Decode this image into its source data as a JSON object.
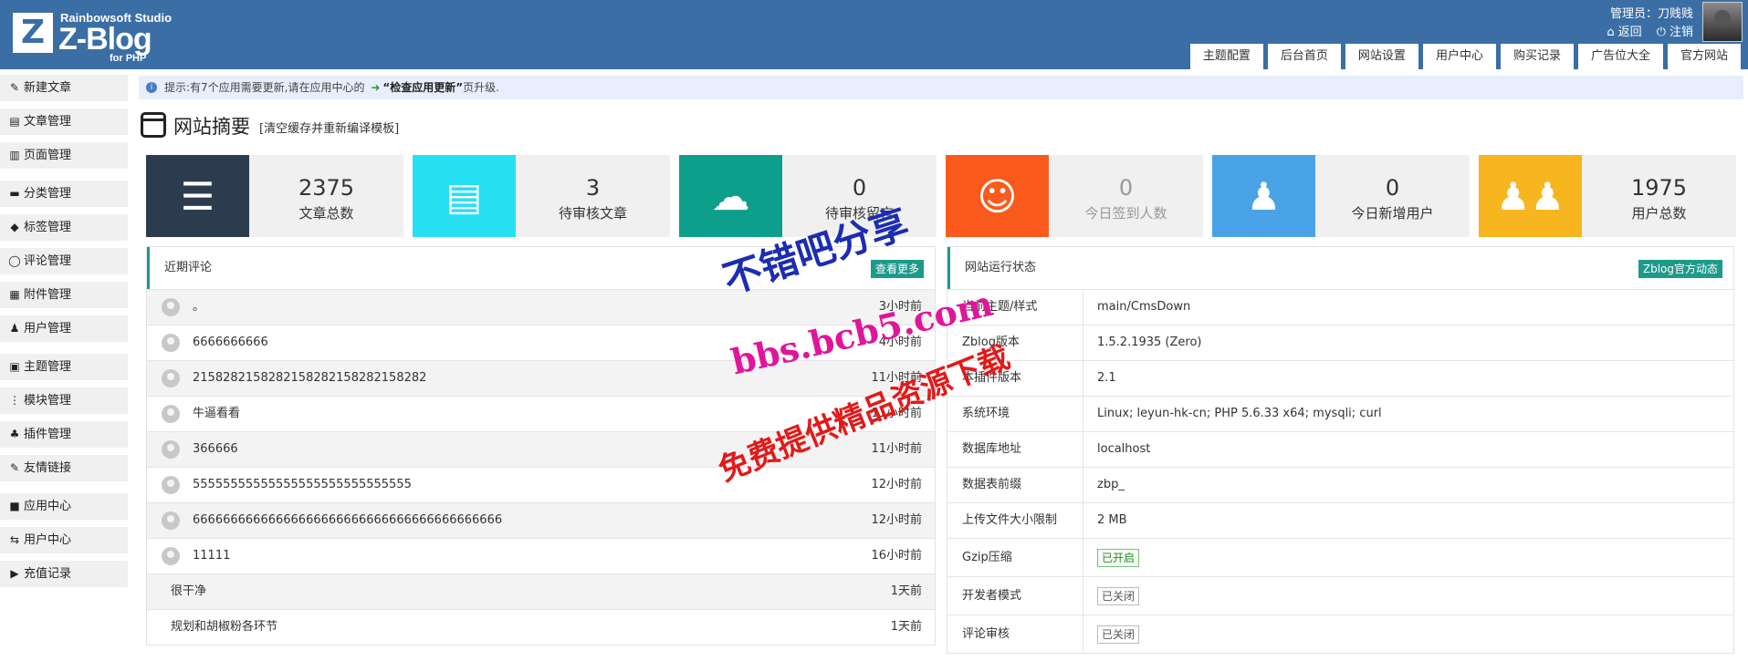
{
  "brand": {
    "logo_letter": "Z",
    "studio": "Rainbowsoft Studio",
    "name": "Z-Blog",
    "sub": "for PHP"
  },
  "admin": {
    "label": "管理员：刀贱贱",
    "back": "返回",
    "logout": "注销"
  },
  "topnav": [
    "主题配置",
    "后台首页",
    "网站设置",
    "用户中心",
    "购买记录",
    "广告位大全",
    "官方网站"
  ],
  "sidebar": [
    {
      "label": "新建文章",
      "icon": "edit-icon"
    },
    {
      "label": "文章管理",
      "icon": "article-icon"
    },
    {
      "label": "页面管理",
      "icon": "page-icon"
    },
    {
      "label": "分类管理",
      "icon": "folder-icon"
    },
    {
      "label": "标签管理",
      "icon": "tag-icon"
    },
    {
      "label": "评论管理",
      "icon": "comment-icon"
    },
    {
      "label": "附件管理",
      "icon": "attachment-icon"
    },
    {
      "label": "用户管理",
      "icon": "user-icon"
    },
    {
      "label": "主题管理",
      "icon": "theme-icon"
    },
    {
      "label": "模块管理",
      "icon": "module-icon"
    },
    {
      "label": "插件管理",
      "icon": "plugin-icon"
    },
    {
      "label": "友情链接",
      "icon": "link-icon"
    },
    {
      "label": "应用中心",
      "icon": "app-center-icon"
    },
    {
      "label": "用户中心",
      "icon": "exchange-icon"
    },
    {
      "label": "充值记录",
      "icon": "play-icon"
    }
  ],
  "notice": {
    "prefix": "提示:有7个应用需要更新,请在应用中心的",
    "link": "“检查应用更新”",
    "suffix": "页升级."
  },
  "summary": {
    "title": "网站摘要",
    "clear_cache": "[清空缓存并重新编译模板]"
  },
  "stats": [
    {
      "value": "2375",
      "label": "文章总数",
      "color": "#2d3b4f",
      "icon": "document-icon"
    },
    {
      "value": "3",
      "label": "待审核文章",
      "color": "#27e0f2",
      "icon": "clipboard-icon"
    },
    {
      "value": "0",
      "label": "待审核留言",
      "color": "#0e9e8c",
      "icon": "chat-icon"
    },
    {
      "value": "0",
      "label": "今日签到人数",
      "color": "#fa5b1c",
      "icon": "smile-icon"
    },
    {
      "value": "0",
      "label": "今日新增用户",
      "color": "#4aa3e6",
      "icon": "user-icon"
    },
    {
      "value": "1975",
      "label": "用户总数",
      "color": "#f7b51f",
      "icon": "users-icon"
    }
  ],
  "comments": {
    "title": "近期评论",
    "more": "查看更多",
    "rows": [
      {
        "text": "。",
        "time": "3小时前",
        "avatar": true
      },
      {
        "text": "6666666666",
        "time": "4小时前",
        "avatar": true
      },
      {
        "text": "2158282158282158282158282158282",
        "time": "11小时前",
        "avatar": true
      },
      {
        "text": "牛逼看看",
        "time": "11小时前",
        "avatar": true
      },
      {
        "text": "366666",
        "time": "11小时前",
        "avatar": true
      },
      {
        "text": "55555555555555555555555555555",
        "time": "12小时前",
        "avatar": true
      },
      {
        "text": "66666666666666666666666666666666666666666",
        "time": "12小时前",
        "avatar": true
      },
      {
        "text": "11111",
        "time": "16小时前",
        "avatar": true
      },
      {
        "text": "很干净",
        "time": "1天前",
        "avatar": false
      },
      {
        "text": "规划和胡椒粉各环节",
        "time": "1天前",
        "avatar": false
      }
    ]
  },
  "status": {
    "title": "网站运行状态",
    "official": "Zblog官方动态",
    "rows": [
      {
        "key": "当前主题/样式",
        "value": "main/CmsDown"
      },
      {
        "key": "Zblog版本",
        "value": "1.5.2.1935 (Zero)"
      },
      {
        "key": "本插件版本",
        "value": "2.1"
      },
      {
        "key": "系统环境",
        "value": "Linux; leyun-hk-cn; PHP 5.6.33 x64; mysqli; curl"
      },
      {
        "key": "数据库地址",
        "value": "localhost"
      },
      {
        "key": "数据表前缀",
        "value": "zbp_"
      },
      {
        "key": "上传文件大小限制",
        "value": "2 MB"
      }
    ],
    "tag_rows": [
      {
        "key": "Gzip压缩",
        "value": "已开启",
        "on": true
      },
      {
        "key": "开发者模式",
        "value": "已关闭",
        "on": false
      },
      {
        "key": "评论审核",
        "value": "已关闭",
        "on": false
      }
    ]
  },
  "watermarks": [
    "不错吧分享",
    "bbs.bcb5.com",
    "免费提供精品资源下载"
  ]
}
